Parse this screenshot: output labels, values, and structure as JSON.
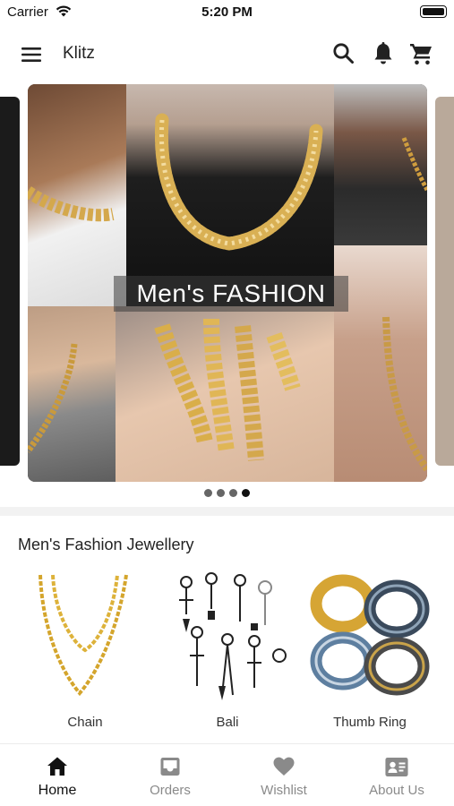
{
  "status_bar": {
    "carrier": "Carrier",
    "time": "5:20 PM",
    "icons": [
      "wifi-icon",
      "battery-icon"
    ]
  },
  "app_bar": {
    "title": "Klitz",
    "icons": [
      "menu-icon",
      "search-icon",
      "bell-icon",
      "cart-icon"
    ]
  },
  "carousel": {
    "banner_text": "Men's FASHION",
    "slide_count": 4,
    "active_index": 3
  },
  "section": {
    "title": "Men's Fashion Jewellery",
    "categories": [
      {
        "label": "Chain",
        "image": "gold-chain-image"
      },
      {
        "label": "Bali",
        "image": "earrings-image"
      },
      {
        "label": "Thumb Ring",
        "image": "rings-image"
      }
    ]
  },
  "tab_bar": {
    "items": [
      {
        "label": "Home",
        "icon": "home-icon",
        "active": true
      },
      {
        "label": "Orders",
        "icon": "inbox-icon",
        "active": false
      },
      {
        "label": "Wishlist",
        "icon": "heart-icon",
        "active": false
      },
      {
        "label": "About Us",
        "icon": "contact-card-icon",
        "active": false
      }
    ]
  },
  "colors": {
    "active_tab": "#111111",
    "inactive_tab": "#8a8a8a",
    "divider": "#f2f2f2",
    "gold": "#d4a52c"
  }
}
